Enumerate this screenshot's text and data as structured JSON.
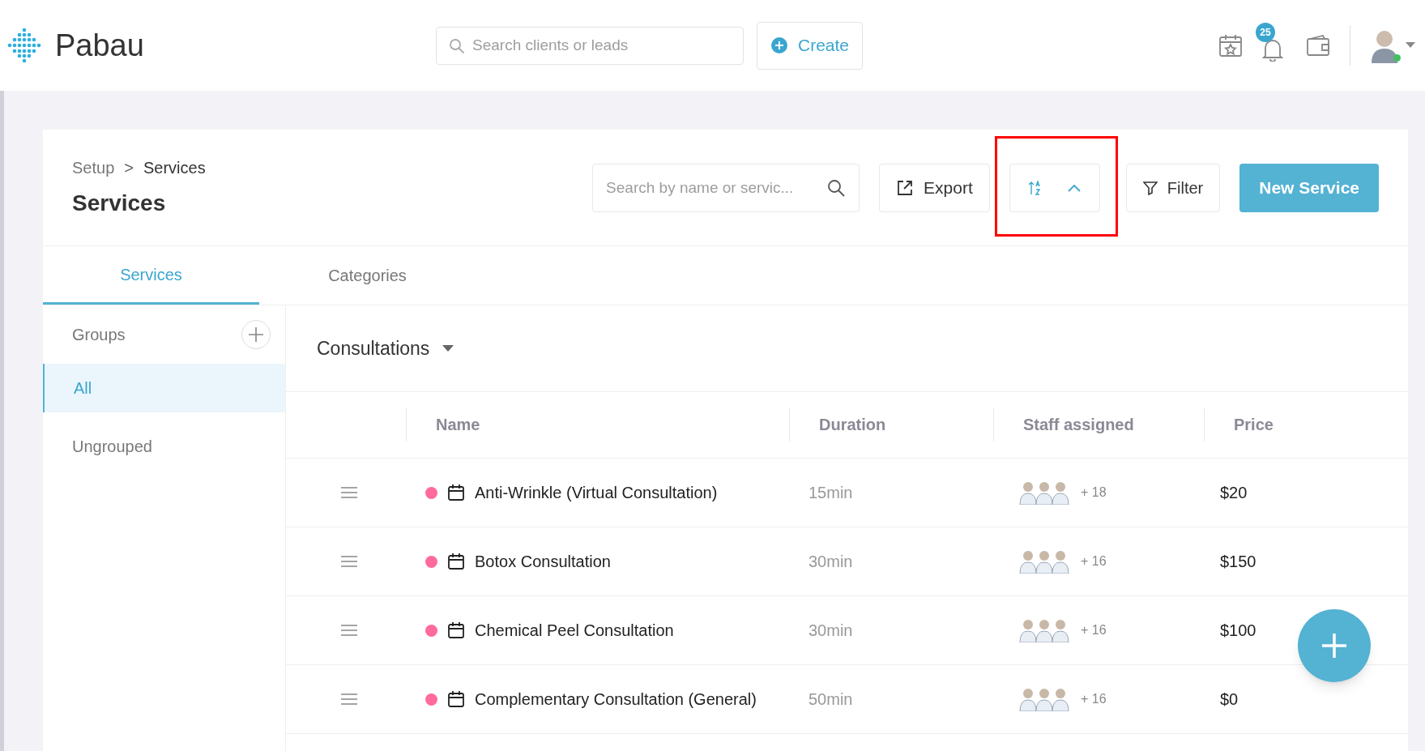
{
  "header": {
    "logo": "Pabau",
    "search": {
      "placeholder": "Search clients or leads"
    },
    "create_button": "Create",
    "notification_count": "25"
  },
  "page": {
    "breadcrumb": [
      "Setup",
      "Services"
    ],
    "breadcrumb_separator": ">",
    "title": "Services",
    "search": {
      "placeholder": "Search by name or servic..."
    },
    "export_button": "Export",
    "filter_button": "Filter",
    "new_button": "New Service"
  },
  "tabs": [
    {
      "label": "Services",
      "selected": true
    },
    {
      "label": "Categories",
      "selected": false
    }
  ],
  "sidebar": {
    "title": "Groups",
    "items": [
      {
        "label": "All",
        "selected": true
      },
      {
        "label": "Ungrouped",
        "selected": false
      }
    ]
  },
  "group": {
    "title": "Consultations"
  },
  "table": {
    "columns": [
      "Name",
      "Duration",
      "Staff assigned",
      "Price"
    ],
    "rows": [
      {
        "name": "Anti-Wrinkle (Virtual Consultation)",
        "color": "#ff6b9a",
        "duration": "15min",
        "staff_more": "+ 18",
        "price": "$20"
      },
      {
        "name": "Botox Consultation",
        "color": "#ff6b9a",
        "duration": "30min",
        "staff_more": "+ 16",
        "price": "$150"
      },
      {
        "name": "Chemical Peel Consultation",
        "color": "#ff6b9a",
        "duration": "30min",
        "staff_more": "+ 16",
        "price": "$100"
      },
      {
        "name": "Complementary Consultation (General)",
        "color": "#ff6b9a",
        "duration": "50min",
        "staff_more": "+ 16",
        "price": "$0"
      }
    ]
  }
}
